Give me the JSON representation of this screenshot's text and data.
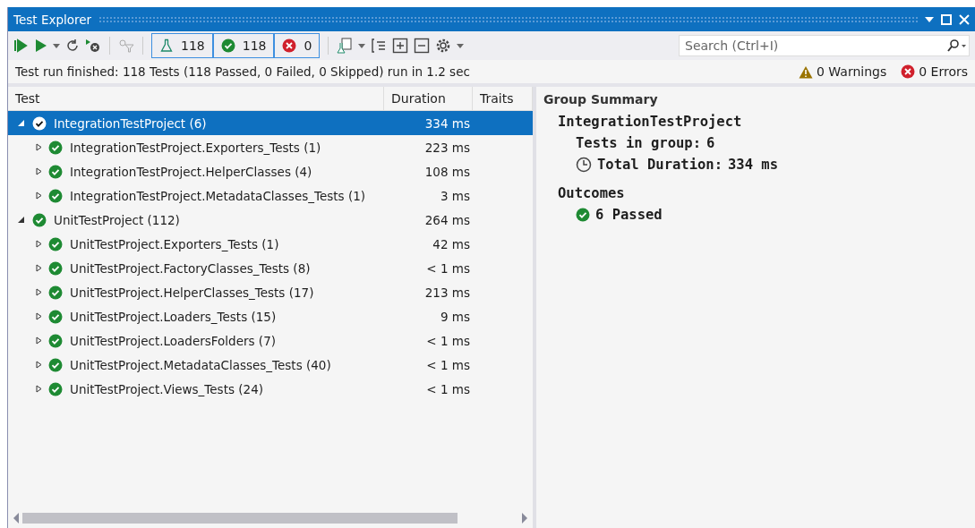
{
  "window": {
    "title": "Test Explorer"
  },
  "toolbar": {
    "counters": [
      {
        "kind": "total",
        "label": "118"
      },
      {
        "kind": "passed",
        "label": "118"
      },
      {
        "kind": "failed",
        "label": "0"
      }
    ],
    "search": {
      "placeholder": "Search (Ctrl+I)"
    }
  },
  "status": {
    "message": "Test run finished: 118 Tests (118 Passed, 0 Failed, 0 Skipped) run in 1.2 sec",
    "warnings": "0 Warnings",
    "errors": "0 Errors"
  },
  "table": {
    "columns": [
      "Test",
      "Duration",
      "Traits"
    ],
    "rows": [
      {
        "name": "IntegrationTestProject (6)",
        "duration": "334 ms",
        "expanded": true,
        "selected": true,
        "children": [
          {
            "name": "IntegrationTestProject.Exporters_Tests (1)",
            "duration": "223 ms",
            "expanded": false,
            "selected": false
          },
          {
            "name": "IntegrationTestProject.HelperClasses (4)",
            "duration": "108 ms",
            "expanded": false,
            "selected": false
          },
          {
            "name": "IntegrationTestProject.MetadataClasses_Tests (1)",
            "duration": "3 ms",
            "expanded": false,
            "selected": false
          }
        ]
      },
      {
        "name": "UnitTestProject (112)",
        "duration": "264 ms",
        "expanded": true,
        "selected": false,
        "children": [
          {
            "name": "UnitTestProject.Exporters_Tests (1)",
            "duration": "42 ms",
            "expanded": false,
            "selected": false
          },
          {
            "name": "UnitTestProject.FactoryClasses_Tests (8)",
            "duration": "< 1 ms",
            "expanded": false,
            "selected": false
          },
          {
            "name": "UnitTestProject.HelperClasses_Tests (17)",
            "duration": "213 ms",
            "expanded": false,
            "selected": false
          },
          {
            "name": "UnitTestProject.Loaders_Tests (15)",
            "duration": "9 ms",
            "expanded": false,
            "selected": false
          },
          {
            "name": "UnitTestProject.LoadersFolders (7)",
            "duration": "< 1 ms",
            "expanded": false,
            "selected": false
          },
          {
            "name": "UnitTestProject.MetadataClasses_Tests (40)",
            "duration": "< 1 ms",
            "expanded": false,
            "selected": false
          },
          {
            "name": "UnitTestProject.Views_Tests (24)",
            "duration": "< 1 ms",
            "expanded": false,
            "selected": false
          }
        ]
      }
    ]
  },
  "summary": {
    "heading": "Group Summary",
    "group": "IntegrationTestProject",
    "tests_label": "Tests in group:",
    "tests_value": "6",
    "duration_label": "Total Duration:",
    "duration_value": "334 ms",
    "outcomes_heading": "Outcomes",
    "outcomes": [
      {
        "kind": "passed",
        "label": "6 Passed"
      }
    ]
  }
}
